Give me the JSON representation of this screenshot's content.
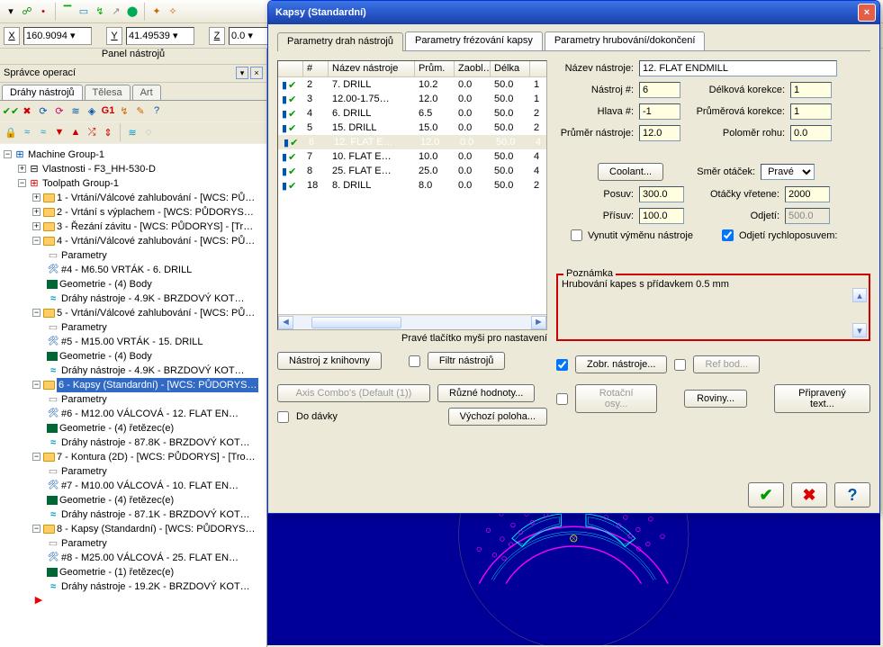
{
  "topbar": {
    "icons": [
      "arrow-right",
      "anchor",
      "dot",
      "square",
      "line-horiz",
      "square-dot",
      "line-poly",
      "arrow-up",
      "block",
      "sep",
      "square-outline",
      "star",
      "sep2"
    ]
  },
  "coords": {
    "x_label": "X",
    "x_value": "160.9094",
    "y_label": "Y",
    "y_value": "41.49539",
    "z_label": "Z",
    "z_value": "0.0"
  },
  "panel_title": "Panel nástrojů",
  "ops_header": "Správce operací",
  "tabs": {
    "a": "Dráhy nástrojů",
    "b": "Tělesa",
    "c": "Art"
  },
  "tree": {
    "root": "Machine Group-1",
    "props": "Vlastnosti - F3_HH-530-D",
    "tpgroup": "Toolpath Group-1",
    "ops": [
      {
        "label": "1 - Vrtání/Válcové zahlubování - [WCS: PŮ…",
        "children": []
      },
      {
        "label": "2 - Vrtání s výplachem - [WCS: PŮDORYS…",
        "children": []
      },
      {
        "label": "3 - Řezání závitu - [WCS: PŮDORYS] - [Tr…",
        "children": []
      },
      {
        "label": "4 - Vrtání/Válcové zahlubování - [WCS: PŮ…",
        "open": true,
        "children": [
          {
            "icon": "params",
            "label": "Parametry"
          },
          {
            "icon": "tool",
            "label": "#4 - M6.50 VRTÁK -   6. DRILL"
          },
          {
            "icon": "geom",
            "label": "Geometrie - (4) Body"
          },
          {
            "icon": "path",
            "label": "Dráhy nástroje - 4.9K - BRZDOVÝ KOT…"
          }
        ]
      },
      {
        "label": "5 - Vrtání/Válcové zahlubování - [WCS: PŮ…",
        "open": true,
        "children": [
          {
            "icon": "params",
            "label": "Parametry"
          },
          {
            "icon": "tool",
            "label": "#5 - M15.00 VRTÁK -   15. DRILL"
          },
          {
            "icon": "geom",
            "label": "Geometrie - (4) Body"
          },
          {
            "icon": "path",
            "label": "Dráhy nástroje - 4.9K - BRZDOVÝ KOT…"
          }
        ]
      },
      {
        "label": "6 - Kapsy (Standardní) - [WCS: PŮDORYS…",
        "open": true,
        "selected": true,
        "children": [
          {
            "icon": "params",
            "label": "Parametry"
          },
          {
            "icon": "tool",
            "label": "#6 - M12.00 VÁLCOVÁ -   12. FLAT EN…"
          },
          {
            "icon": "geom",
            "label": "Geometrie - (4) řetězec(e)"
          },
          {
            "icon": "path",
            "label": "Dráhy nástroje - 87.8K - BRZDOVÝ KOT…"
          }
        ]
      },
      {
        "label": "7 - Kontura (2D) - [WCS: PŮDORYS] - [Tro…",
        "open": true,
        "children": [
          {
            "icon": "params",
            "label": "Parametry"
          },
          {
            "icon": "tool",
            "label": "#7 - M10.00 VÁLCOVÁ -   10. FLAT EN…"
          },
          {
            "icon": "geom",
            "label": "Geometrie - (4) řetězec(e)"
          },
          {
            "icon": "path",
            "label": "Dráhy nástroje - 87.1K - BRZDOVÝ KOT…"
          }
        ]
      },
      {
        "label": "8 - Kapsy (Standardní) - [WCS: PŮDORYS…",
        "open": true,
        "children": [
          {
            "icon": "params",
            "label": "Parametry"
          },
          {
            "icon": "tool",
            "label": "#8 - M25.00 VÁLCOVÁ -   25. FLAT EN…"
          },
          {
            "icon": "geom",
            "label": "Geometrie - (1) řetězec(e)"
          },
          {
            "icon": "path",
            "label": "Dráhy nástroje - 19.2K - BRZDOVÝ KOT…"
          }
        ]
      }
    ]
  },
  "dialog": {
    "title": "Kapsy (Standardní)",
    "main_tabs": {
      "a": "Parametry drah nástrojů",
      "b": "Parametry frézování kapsy",
      "c": "Parametry hrubování/dokončení"
    },
    "list_headers": {
      "num": "#",
      "name": "Název nástroje",
      "diam": "Prům.",
      "rad": "Zaobl…",
      "len": "Délka"
    },
    "tools": [
      {
        "n": "2",
        "name": "7. DRILL",
        "d": "10.2",
        "r": "0.0",
        "l": "50.0",
        "e": "1"
      },
      {
        "n": "3",
        "name": "12.00-1.75…",
        "d": "12.0",
        "r": "0.0",
        "l": "50.0",
        "e": "1"
      },
      {
        "n": "4",
        "name": "6. DRILL",
        "d": "6.5",
        "r": "0.0",
        "l": "50.0",
        "e": "2"
      },
      {
        "n": "5",
        "name": "15. DRILL",
        "d": "15.0",
        "r": "0.0",
        "l": "50.0",
        "e": "2"
      },
      {
        "n": "6",
        "name": "12. FLAT E…",
        "d": "12.0",
        "r": "0.0",
        "l": "50.0",
        "e": "4",
        "sel": true
      },
      {
        "n": "7",
        "name": "10. FLAT E…",
        "d": "10.0",
        "r": "0.0",
        "l": "50.0",
        "e": "4"
      },
      {
        "n": "8",
        "name": "25. FLAT E…",
        "d": "25.0",
        "r": "0.0",
        "l": "50.0",
        "e": "4"
      },
      {
        "n": "18",
        "name": "8. DRILL",
        "d": "8.0",
        "r": "0.0",
        "l": "50.0",
        "e": "2"
      }
    ],
    "rc_hint": "Pravé tlačítko myši pro nastavení",
    "btn_library": "Nástroj z knihovny",
    "btn_filter": "Filtr nástrojů",
    "btn_axis": "Axis Combo's (Default (1))",
    "btn_values": "Různé hodnoty...",
    "chk_batch": "Do dávky",
    "btn_home": "Výchozí poloha...",
    "btn_rotary": "Rotační osy...",
    "chk_show_tool": "Zobr. nástroje...",
    "btn_planes": "Roviny...",
    "btn_refpt": "Ref bod...",
    "btn_canned": "Připravený text...",
    "form": {
      "tool_name_label": "Název nástroje:",
      "tool_name": "12. FLAT ENDMILL",
      "tool_no_label": "Nástroj #:",
      "tool_no": "6",
      "len_off_label": "Délková korekce:",
      "len_off": "1",
      "head_label": "Hlava #:",
      "head": "-1",
      "dia_off_label": "Průměrová korekce:",
      "dia_off": "1",
      "tool_dia_label": "Průměr nástroje:",
      "tool_dia": "12.0",
      "corner_label": "Poloměr rohu:",
      "corner": "0.0",
      "coolant_btn": "Coolant...",
      "spin_dir_label": "Směr otáček:",
      "spin_dir": "Pravé",
      "feed_label": "Posuv:",
      "feed": "300.0",
      "spindle_label": "Otáčky vřetene:",
      "spindle": "2000",
      "plunge_label": "Přísuv:",
      "plunge": "100.0",
      "retract_label": "Odjetí:",
      "retract": "500.0",
      "force_change": "Vynutit výměnu nástroje",
      "rapid_retract": "Odjetí rychloposuvem:"
    },
    "note_legend": "Poznámka",
    "note_text": "Hrubování kapes s přídavkem 0.5 mm"
  }
}
